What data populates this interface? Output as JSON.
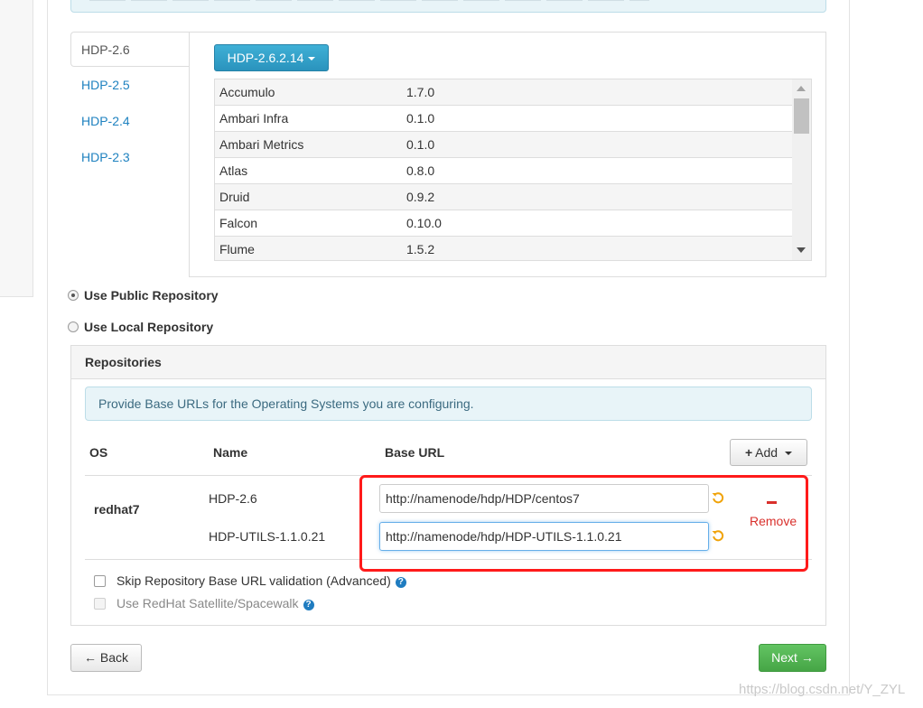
{
  "stack_tabs": [
    {
      "label": "HDP-2.6",
      "active": true
    },
    {
      "label": "HDP-2.5",
      "active": false
    },
    {
      "label": "HDP-2.4",
      "active": false
    },
    {
      "label": "HDP-2.3",
      "active": false
    }
  ],
  "version_dropdown": {
    "label": "HDP-2.6.2.14"
  },
  "services": [
    {
      "name": "Accumulo",
      "version": "1.7.0"
    },
    {
      "name": "Ambari Infra",
      "version": "0.1.0"
    },
    {
      "name": "Ambari Metrics",
      "version": "0.1.0"
    },
    {
      "name": "Atlas",
      "version": "0.8.0"
    },
    {
      "name": "Druid",
      "version": "0.9.2"
    },
    {
      "name": "Falcon",
      "version": "0.10.0"
    },
    {
      "name": "Flume",
      "version": "1.5.2"
    }
  ],
  "repo_options": {
    "public_label": "Use Public Repository",
    "local_label": "Use Local Repository",
    "selected": "public"
  },
  "repositories": {
    "title": "Repositories",
    "info": "Provide Base URLs for the Operating Systems you are configuring.",
    "columns": {
      "os": "OS",
      "name": "Name",
      "base_url": "Base URL"
    },
    "add_label": "Add",
    "os": "redhat7",
    "rows": [
      {
        "name": "HDP-2.6",
        "url": "http://namenode/hdp/HDP/centos7"
      },
      {
        "name": "HDP-UTILS-1.1.0.21",
        "url": "http://namenode/hdp/HDP-UTILS-1.1.0.21"
      }
    ],
    "remove_label": "Remove",
    "skip_validation_label": "Skip Repository Base URL validation (Advanced)",
    "satellite_label": "Use RedHat Satellite/Spacewalk"
  },
  "footer": {
    "back_label": "← Back",
    "next_label": "Next →"
  },
  "watermark": "https://blog.csdn.net/Y_ZYL",
  "colors": {
    "link": "#1f82c0",
    "primary_dropdown": "#2a93bd",
    "success": "#46a546",
    "danger": "#d9302c",
    "highlight": "#ff1a1a"
  }
}
